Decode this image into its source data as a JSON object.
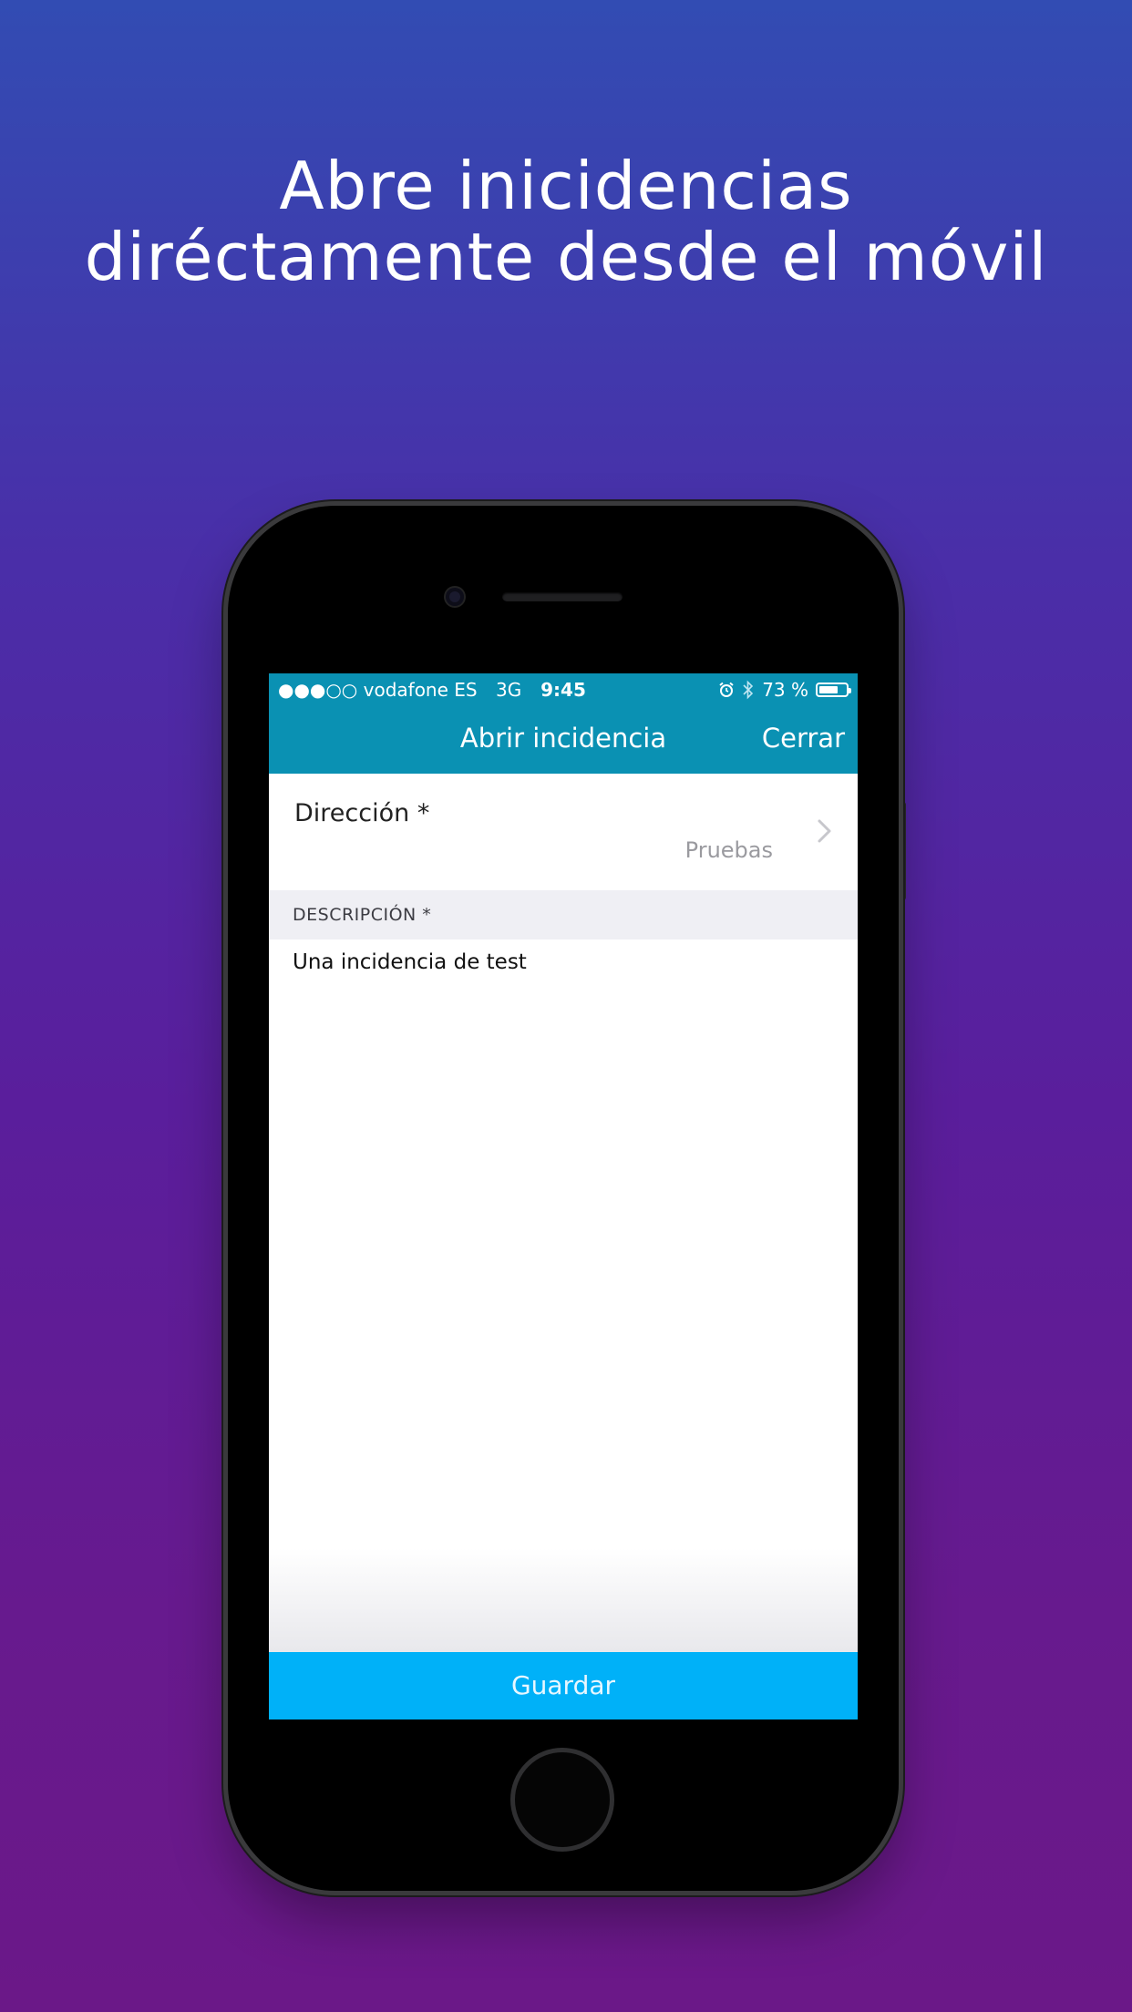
{
  "headline": {
    "line1": "Abre inicidencias",
    "line2": "diréctamente desde el móvil"
  },
  "status_bar": {
    "signal": "●●●○○",
    "carrier": "vodafone ES",
    "network": "3G",
    "time": "9:45",
    "battery_percent_text": "73 %",
    "battery_level": 73,
    "alarm_icon": "alarm-icon",
    "bluetooth_icon": "bluetooth-icon"
  },
  "nav": {
    "title": "Abrir incidencia",
    "close_label": "Cerrar"
  },
  "form": {
    "address_label": "Dirección *",
    "address_value": "Pruebas",
    "description_header": "DESCRIPCIÓN *",
    "description_text": "Una incidencia de test"
  },
  "footer": {
    "save_label": "Guardar"
  },
  "colors": {
    "header": "#0a91b3",
    "save_button": "#00b1f8",
    "background_top": "#324cb3",
    "background_bottom": "#6b1888"
  }
}
